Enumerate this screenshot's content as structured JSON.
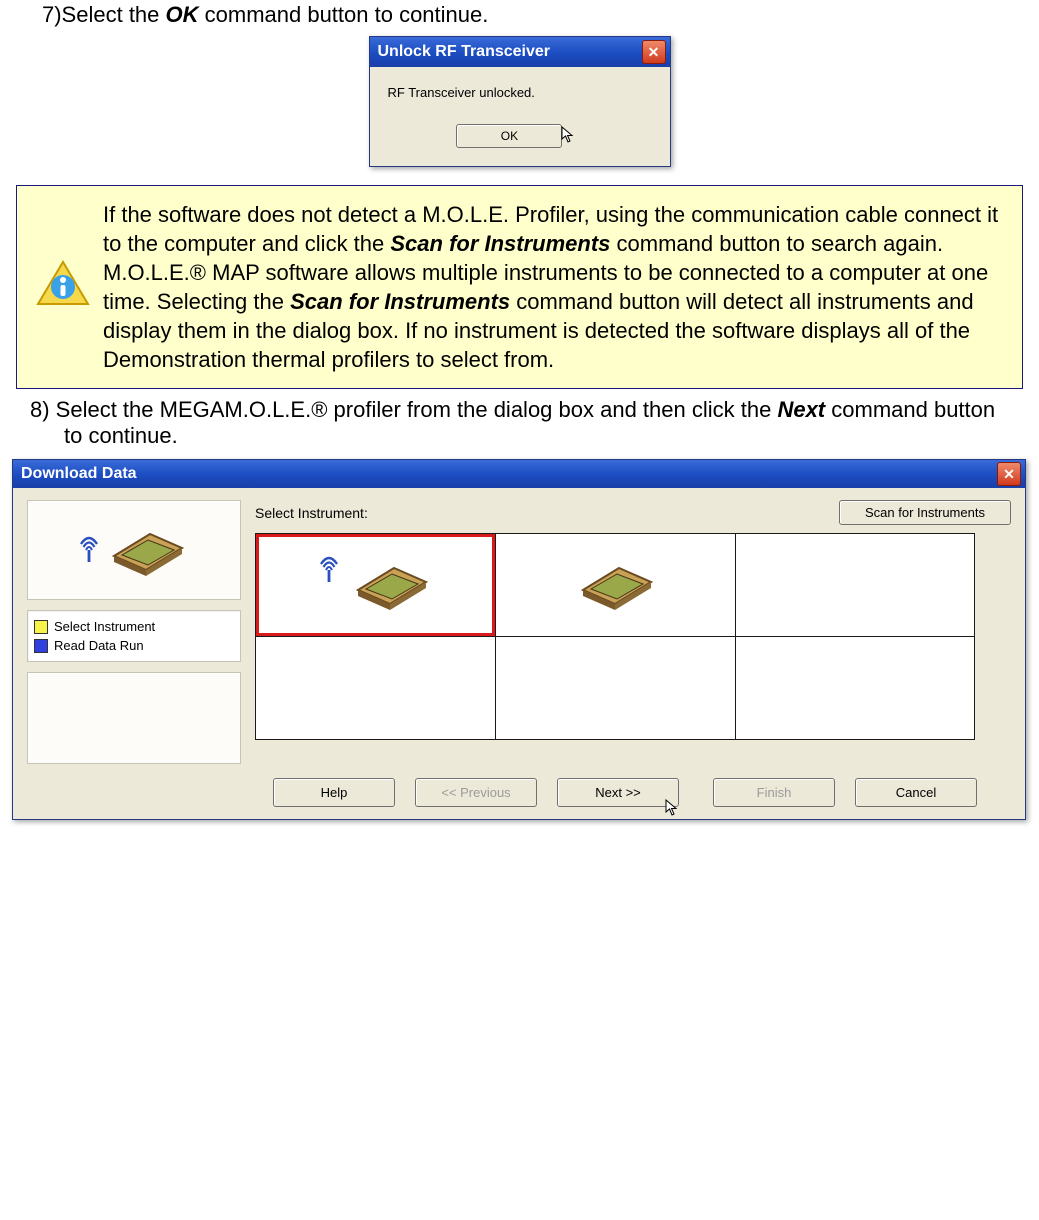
{
  "step7": {
    "prefix": "7)Select the ",
    "bold": "OK",
    "suffix": " command button to continue."
  },
  "dialog1": {
    "title": "Unlock RF Transceiver",
    "message": "RF Transceiver unlocked.",
    "ok": "OK"
  },
  "note": {
    "p1a": "If the software does not detect a M.O.L.E. Profiler, using the communication cable connect it to the computer and click the ",
    "b1": "Scan for Instruments",
    "p1b": " command button to search again. M.O.L.E.® MAP software allows multiple instruments to be connected to a computer at one time. Selecting the ",
    "b2": "Scan for Instruments",
    "p1c": " command button will detect all instruments and display them in the dialog box. If no instrument is detected the software displays all of the Demonstration thermal profilers to select from."
  },
  "step8": {
    "prefix": "8)  Select the MEGAM.O.L.E.® profiler from the dialog box and then click the ",
    "bold": "Next",
    "suffix": " command button to continue."
  },
  "dialog2": {
    "title": "Download Data",
    "selectLabel": "Select Instrument:",
    "scanBtn": "Scan for Instruments",
    "steps": [
      "Select Instrument",
      "Read Data Run"
    ],
    "buttons": {
      "help": "Help",
      "prev": "<< Previous",
      "next": "Next >>",
      "finish": "Finish",
      "cancel": "Cancel"
    }
  }
}
